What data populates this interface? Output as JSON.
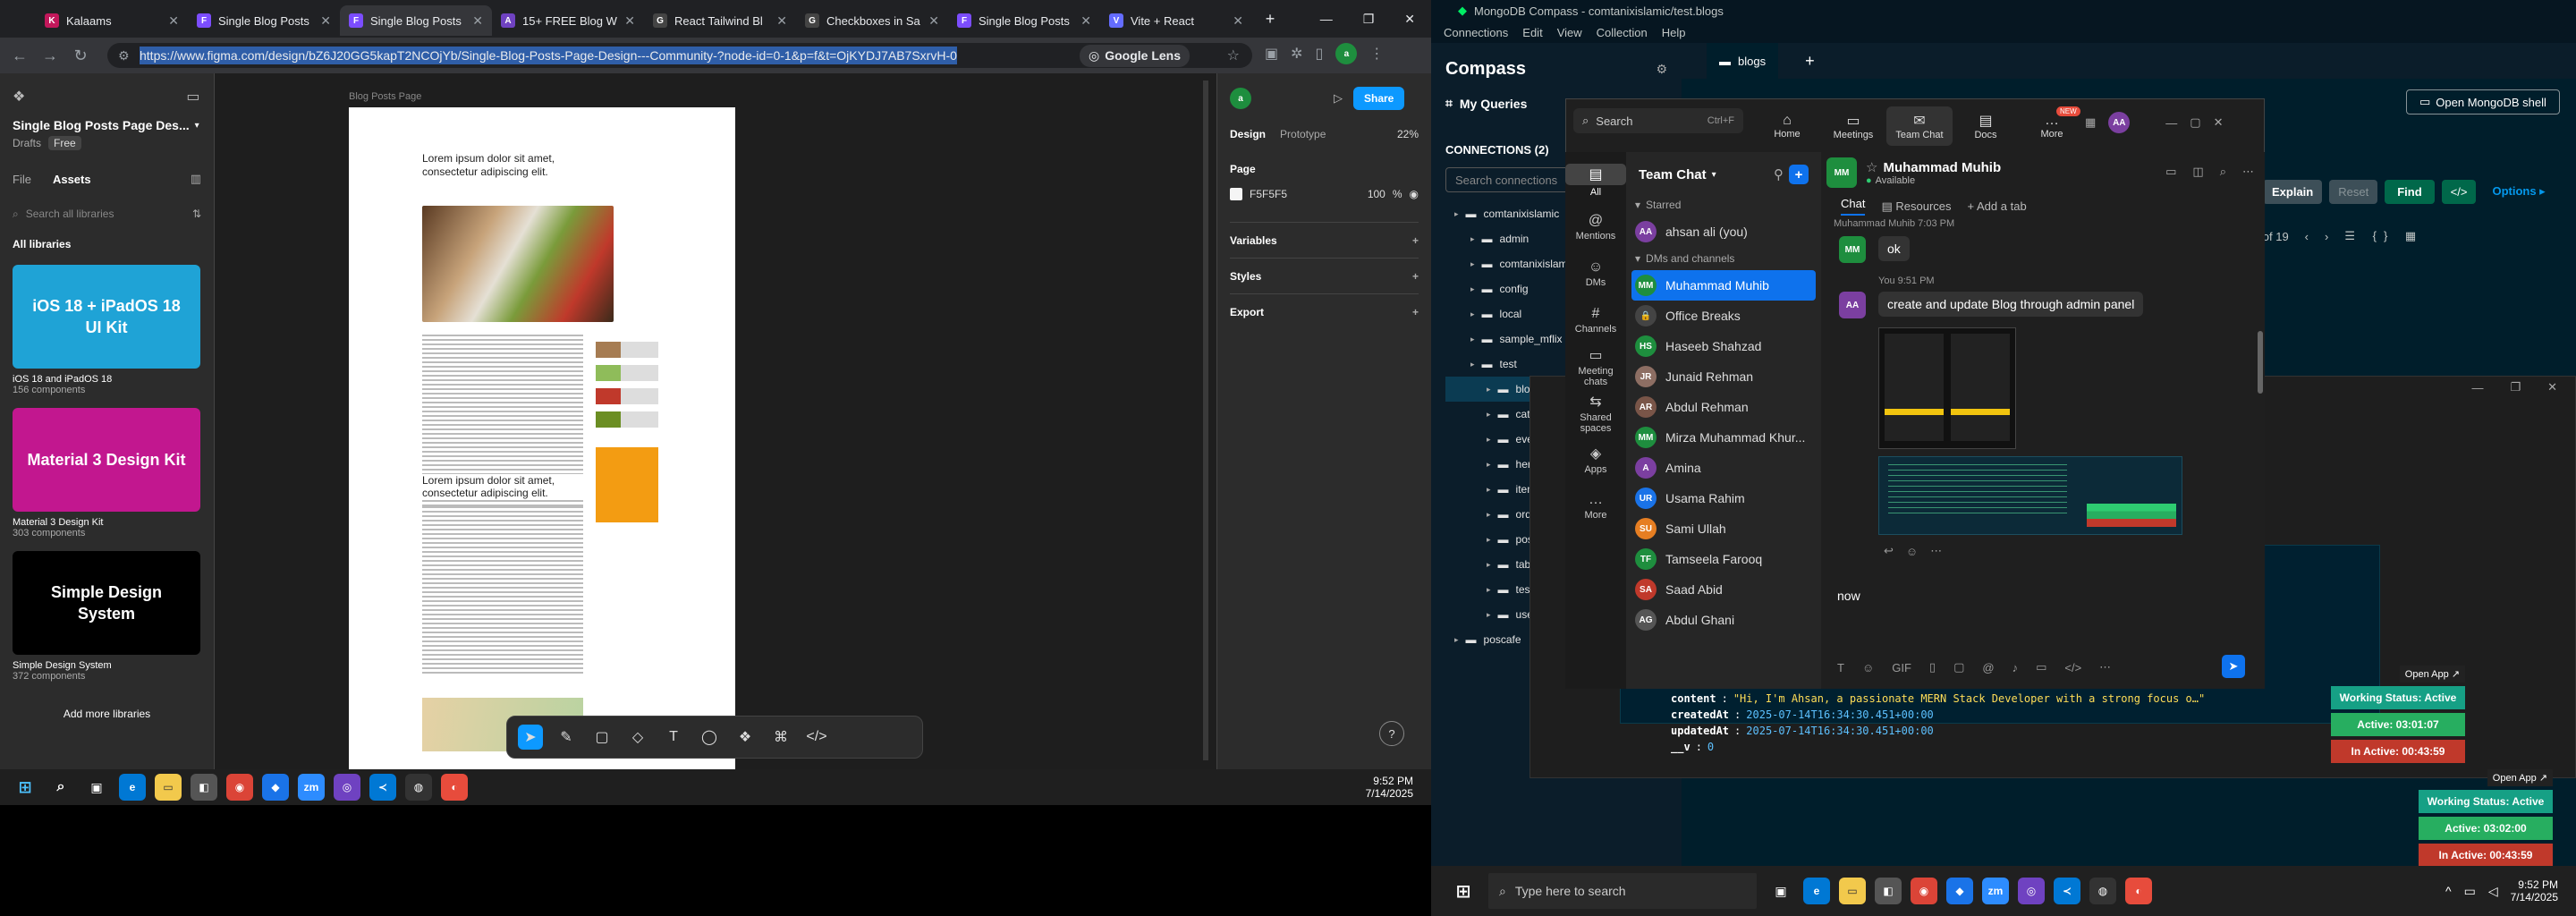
{
  "chrome": {
    "tabs": [
      {
        "label": "Kalaams",
        "color": "#c2185b",
        "icon": "K"
      },
      {
        "label": "Single Blog Posts",
        "color": "#7c4dff",
        "icon": "F"
      },
      {
        "label": "Single Blog Posts",
        "color": "#7c4dff",
        "icon": "F",
        "active": true
      },
      {
        "label": "15+ FREE Blog W",
        "color": "#6f42c1",
        "icon": "A"
      },
      {
        "label": "React Tailwind Bl",
        "color": "#444",
        "icon": "G"
      },
      {
        "label": "Checkboxes in Sa",
        "color": "#444",
        "icon": "G"
      },
      {
        "label": "Single Blog Posts",
        "color": "#7c4dff",
        "icon": "F"
      },
      {
        "label": "Vite + React",
        "color": "#646cff",
        "icon": "V"
      }
    ],
    "new_tab": "+",
    "url_prefix": "https://www.figma.com/design/",
    "url_rest": "bZ6J20GG5kapT2NCOjYb/Single-Blog-Posts-Page-Design---Community-?node-id=0-1&p=f&t=OjKYDJ7AB7SxrvH-0",
    "google_lens": "Google Lens",
    "window_controls": [
      "—",
      "❐",
      "✕"
    ]
  },
  "figma": {
    "file_name": "Single Blog Posts Page Des...",
    "drafts": "Drafts",
    "free_badge": "Free",
    "tabs": [
      "File",
      "Assets"
    ],
    "search_placeholder": "Search all libraries",
    "libraries_heading": "All libraries",
    "kits": [
      {
        "name": "iOS 18 and iPadOS 18",
        "count": "156 components",
        "title": "iOS 18 + iPadOS 18 UI Kit",
        "bg": "#1fa3d6"
      },
      {
        "name": "Material 3 Design Kit",
        "count": "303 components",
        "title": "Material 3 Design Kit",
        "bg": "#c2178f"
      },
      {
        "name": "Simple Design System",
        "count": "372 components",
        "title": "Simple Design System",
        "bg": "#000"
      }
    ],
    "add_libraries": "Add more libraries",
    "artboard_label": "Blog Posts Page",
    "article_title": "Lorem ipsum dolor sit amet, consectetur adipiscing elit.",
    "article_title2": "Lorem ipsum dolor sit amet, consectetur adipiscing elit.",
    "share": "Share",
    "zoom": "22%",
    "design_tab": "Design",
    "prototype_tab": "Prototype",
    "page_label": "Page",
    "page_color": "F5F5F5",
    "page_opacity": "100",
    "percent_sign": "%",
    "sections": [
      "Variables",
      "Styles",
      "Export"
    ],
    "help": "?"
  },
  "taskbar_left": {
    "time": "9:52 PM",
    "date": "7/14/2025"
  },
  "compass": {
    "title": "MongoDB Compass - comtanixislamic/test.blogs",
    "menu": [
      "Connections",
      "Edit",
      "View",
      "Collection",
      "Help"
    ],
    "app_name": "Compass",
    "my_queries": "My Queries",
    "connections": "CONNECTIONS (2)",
    "search_placeholder": "Search connections",
    "tree": [
      "comtanixislamic",
      "admin",
      "comtanixislamic",
      "config",
      "local",
      "sample_mflix",
      "test",
      "blogs",
      "categories",
      "events",
      "heroes",
      "items",
      "orders",
      "posts",
      "tabs",
      "tests",
      "users",
      "poscafe"
    ],
    "tab": "blogs",
    "open_shell": "Open MongoDB shell",
    "explain": "Explain",
    "reset": "Reset",
    "find": "Find",
    "options": "Options",
    "pagination": "1 – 19 of 19",
    "doc_fields": [
      {
        "key": "content",
        "value": "\"Hi, I'm Ahsan, a passionate MERN Stack Developer with a strong focus o…\""
      },
      {
        "key": "createdAt",
        "value": "2025-07-14T16:34:30.451+00:00"
      },
      {
        "key": "updatedAt",
        "value": "2025-07-14T16:34:30.451+00:00"
      },
      {
        "key": "__v",
        "value": "0"
      }
    ]
  },
  "teams": {
    "search": "Search",
    "shortcut": "Ctrl+F",
    "nav": [
      {
        "label": "Home",
        "icon": "⌂"
      },
      {
        "label": "Meetings",
        "icon": "▭"
      },
      {
        "label": "Team Chat",
        "icon": "✉"
      },
      {
        "label": "Docs",
        "icon": "▤"
      },
      {
        "label": "More",
        "icon": "…"
      }
    ],
    "new_badge": "NEW",
    "rail": [
      {
        "label": "All",
        "icon": "▤"
      },
      {
        "label": "Mentions",
        "icon": "@"
      },
      {
        "label": "DMs",
        "icon": "☺"
      },
      {
        "label": "Channels",
        "icon": "#"
      },
      {
        "label": "Meeting chats",
        "icon": "▭"
      },
      {
        "label": "Shared spaces",
        "icon": "⇆"
      },
      {
        "label": "Apps",
        "icon": "◈"
      },
      {
        "label": "More",
        "icon": "…"
      }
    ],
    "list_title": "Team Chat",
    "starred": "Starred",
    "self": {
      "name": "ahsan ali (you)",
      "initials": "AA",
      "color": "#7b3fa0"
    },
    "dms_heading": "DMs and channels",
    "contacts": [
      {
        "name": "Muhammad Muhib",
        "initials": "MM",
        "color": "#1e8e3e",
        "active": true
      },
      {
        "name": "Office Breaks",
        "initials": "🔒",
        "color": "#444"
      },
      {
        "name": "Haseeb Shahzad",
        "initials": "HS",
        "color": "#1e8e3e"
      },
      {
        "name": "Junaid Rehman",
        "initials": "JR",
        "color": "#8d6e63"
      },
      {
        "name": "Abdul Rehman",
        "initials": "AR",
        "color": "#795548"
      },
      {
        "name": "Mirza Muhammad Khur...",
        "initials": "MM",
        "color": "#1e8e3e"
      },
      {
        "name": "Amina",
        "initials": "A",
        "color": "#7b3fa0"
      },
      {
        "name": "Usama Rahim",
        "initials": "UR",
        "color": "#1a73e8"
      },
      {
        "name": "Sami Ullah",
        "initials": "SU",
        "color": "#e67e22"
      },
      {
        "name": "Tamseela Farooq",
        "initials": "TF",
        "color": "#1e8e3e"
      },
      {
        "name": "Saad Abid",
        "initials": "SA",
        "color": "#c0392b"
      },
      {
        "name": "Abdul Ghani",
        "initials": "AG",
        "color": "#555"
      }
    ],
    "chat_name": "Muhammad Muhib",
    "chat_status": "Available",
    "chat_tabs": [
      "Chat",
      "Resources",
      "Add a tab"
    ],
    "messages": [
      {
        "sender": "Muhammad Muhib",
        "time": "7:03 PM",
        "text": "ok",
        "initials": "MM",
        "color": "#1e8e3e"
      },
      {
        "sender": "You",
        "time": "9:51 PM",
        "text": "create and update Blog through admin panel",
        "initials": "AA",
        "color": "#7b3fa0"
      }
    ],
    "composer_text": "now"
  },
  "status_widgets": [
    {
      "open": "Open App ↗",
      "working": "Working Status: Active",
      "active": "Active: 03:01:07",
      "inactive": "In Active: 00:43:59"
    },
    {
      "open": "Open App ↗",
      "working": "Working Status: Active",
      "active": "Active: 03:02:00",
      "inactive": "In Active: 00:43:59"
    }
  ],
  "taskbar_right": {
    "search": "Type here to search",
    "time": "9:52 PM",
    "date": "7/14/2025"
  }
}
